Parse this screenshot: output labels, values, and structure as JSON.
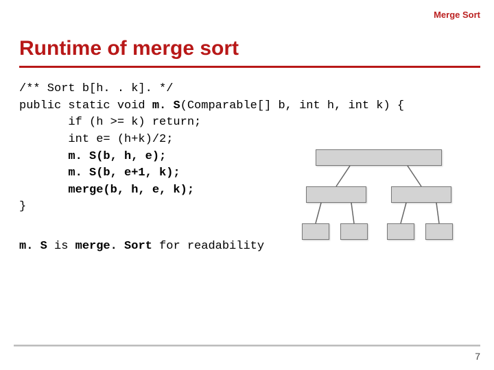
{
  "header": {
    "label": "Merge Sort"
  },
  "title": "Runtime of merge sort",
  "code": {
    "l1": "/** Sort b[h. . k]. */",
    "l2a": "public static void ",
    "l2b": "m. S",
    "l2c": "(Comparable[] b, int h, int k) {",
    "l3": "       if (h >= k) return;",
    "l4": "       int e= (h+k)/2;",
    "l5": "       m. S(b, h, e);",
    "l6": "       m. S(b, e+1, k);",
    "l7": "       merge(b, h, e, k);",
    "l8": "}"
  },
  "annotation": {
    "a1": "m. S",
    "a2": " is ",
    "a3": "merge. Sort",
    "a4": " for readability"
  },
  "page_number": "7"
}
